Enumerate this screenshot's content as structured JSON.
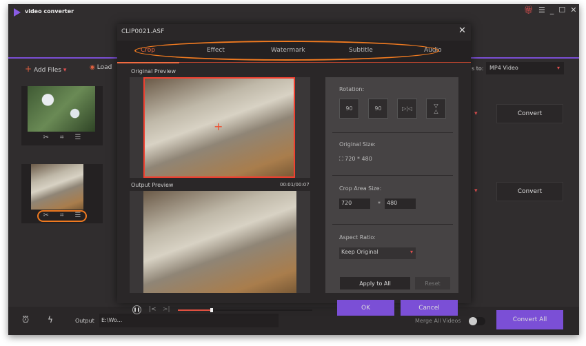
{
  "app": {
    "title": "video converter",
    "accent": "#7b4fd6",
    "highlight": "#f07a20"
  },
  "titlebar": {
    "icons": [
      "gift-icon",
      "menu-icon",
      "minimize-icon",
      "maximize-icon",
      "close-icon"
    ]
  },
  "toolbar": {
    "add_files": "Add Files",
    "load": "Load",
    "convert_to_label": "s to:",
    "format": "MP4 Video"
  },
  "files": [
    {
      "convert_label": "Convert"
    },
    {
      "convert_label": "Convert"
    }
  ],
  "bottom": {
    "output_label": "Output",
    "output_path": "E:\\Wo...",
    "merge_label": "Merge All Videos",
    "convert_all": "Convert All"
  },
  "dialog": {
    "title": "CLIP0021.ASF",
    "tabs": [
      "Crop",
      "Effect",
      "Watermark",
      "Subtitle",
      "Audio"
    ],
    "active_tab": "Crop",
    "original_preview": "Original Preview",
    "output_preview": "Output Preview",
    "time": "00:01/00:07",
    "progress": 0.25,
    "rotation_label": "Rotation:",
    "rotation_buttons": [
      "90",
      "90"
    ],
    "original_size_label": "Original Size:",
    "original_size": "720 * 480",
    "crop_area_label": "Crop Area Size:",
    "crop_width": "720",
    "crop_sep": "*",
    "crop_height": "480",
    "aspect_label": "Aspect Ratio:",
    "aspect_value": "Keep Original",
    "apply_all": "Apply to All",
    "reset": "Reset",
    "ok": "OK",
    "cancel": "Cancel"
  }
}
